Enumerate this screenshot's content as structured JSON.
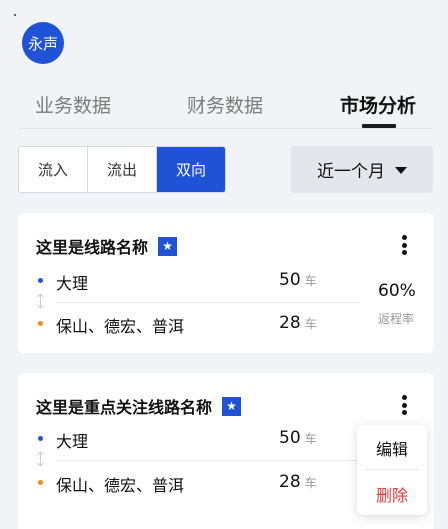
{
  "avatar": {
    "text": "永声",
    "color": "#1f52d6"
  },
  "tabs": [
    {
      "label": "业务数据",
      "active": false
    },
    {
      "label": "财务数据",
      "active": false
    },
    {
      "label": "市场分析",
      "active": true
    }
  ],
  "direction_filter": {
    "options": [
      "流入",
      "流出",
      "双向"
    ],
    "selected": "双向"
  },
  "period_select": {
    "label": "近一个月",
    "icon": "caret-down-icon"
  },
  "routes": [
    {
      "title": "这里是线路名称",
      "favorite_icon": "star-icon",
      "stops": [
        {
          "name": "大理",
          "count": "50",
          "unit": "车",
          "dot_color": "#1f52d6"
        },
        {
          "name": "保山、德宏、普洱",
          "count": "28",
          "unit": "车",
          "dot_color": "#f28a1a"
        }
      ],
      "return_rate": "60%",
      "return_rate_label": "返程率"
    },
    {
      "title": "这里是重点关注线路名称",
      "favorite_icon": "star-icon",
      "stops": [
        {
          "name": "大理",
          "count": "50",
          "unit": "车",
          "dot_color": "#1f52d6"
        },
        {
          "name": "保山、德宏、普洱",
          "count": "28",
          "unit": "车",
          "dot_color": "#f28a1a"
        }
      ]
    }
  ],
  "context_menu": {
    "items": [
      {
        "label": "编辑",
        "color": "#111111"
      },
      {
        "label": "删除",
        "color": "#e03a3a"
      }
    ]
  }
}
